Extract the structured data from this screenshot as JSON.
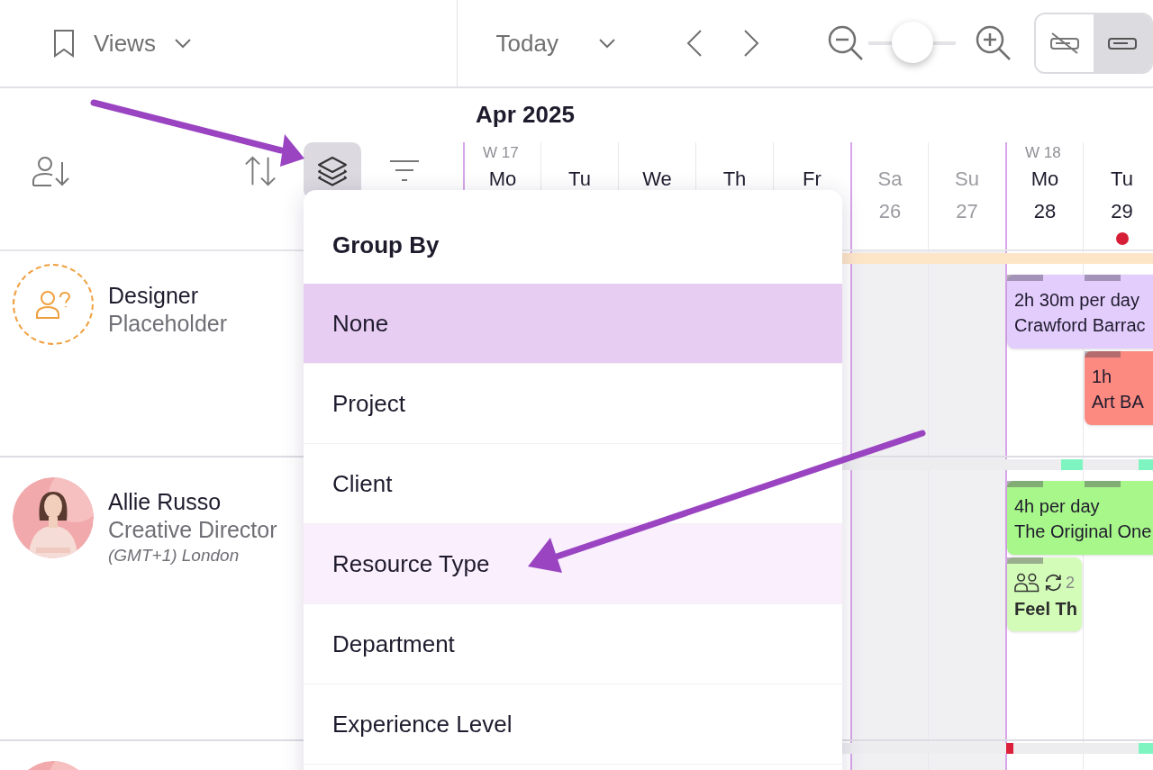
{
  "top_bar": {
    "views_label": "Views",
    "today_label": "Today",
    "zoom": {
      "level": 0.5
    },
    "display_toggles": [
      {
        "kind": "hidden",
        "selected": false
      },
      {
        "kind": "shown",
        "selected": true
      }
    ]
  },
  "list_tools": [
    {
      "kind": "assign",
      "selected": false
    },
    {
      "kind": "sort",
      "selected": false
    },
    {
      "kind": "group",
      "selected": true
    },
    {
      "kind": "filter",
      "selected": false
    }
  ],
  "group_menu": {
    "title": "Group By",
    "items": [
      {
        "label": "None",
        "selected": true,
        "hovered": false
      },
      {
        "label": "Project",
        "selected": false,
        "hovered": false
      },
      {
        "label": "Client",
        "selected": false,
        "hovered": false
      },
      {
        "label": "Resource Type",
        "selected": false,
        "hovered": true
      },
      {
        "label": "Department",
        "selected": false,
        "hovered": false
      },
      {
        "label": "Experience Level",
        "selected": false,
        "hovered": false
      }
    ]
  },
  "calendar": {
    "month": "Apr 2025",
    "days": [
      {
        "week": "W 17",
        "name": "Mo",
        "weekend": false
      },
      {
        "name": "Tu",
        "weekend": false
      },
      {
        "name": "We",
        "weekend": false
      },
      {
        "name": "Th",
        "weekend": false
      },
      {
        "name": "Fr",
        "weekend": false
      },
      {
        "name": "Sa",
        "date": "26",
        "weekend": true,
        "today": false
      },
      {
        "name": "Su",
        "date": "27",
        "weekend": true,
        "today": false
      },
      {
        "week": "W 18",
        "name": "Mo",
        "date": "28",
        "weekend": false,
        "today": false
      },
      {
        "name": "Tu",
        "date": "29",
        "weekend": false,
        "today": true
      }
    ]
  },
  "people": [
    {
      "kind": "placeholder",
      "name": "Designer",
      "role": "Placeholder",
      "strip": {
        "color": "#fde6c8"
      },
      "events": [
        {
          "kind": "standard",
          "lines": [
            "2h 30m per day",
            "Crawford Barrac"
          ],
          "color": "#e3cdfd"
        },
        {
          "kind": "standard",
          "lines": [
            "1h",
            "Art BA"
          ],
          "color": "#fd8a80"
        }
      ]
    },
    {
      "kind": "person",
      "name": "Allie Russo",
      "role": "Creative Director",
      "timezone": "(GMT+1) London",
      "strip": {
        "color": "#ededf0",
        "marks": [
          {
            "color": "#7ef5c0"
          },
          {
            "color": "#7ef5c0"
          }
        ]
      },
      "events": [
        {
          "kind": "standard",
          "lines": [
            "4h per day",
            "The Original One"
          ],
          "color": "#a8f78a"
        },
        {
          "kind": "compact",
          "count": "2",
          "title": "Feel Th",
          "color": "#d2fcb8"
        }
      ]
    },
    {
      "kind": "person",
      "strip": {
        "color": "#ededf0",
        "marks": [
          {
            "color": "#dc1f3a"
          },
          {
            "color": "#7ef5c0"
          }
        ]
      }
    }
  ]
}
